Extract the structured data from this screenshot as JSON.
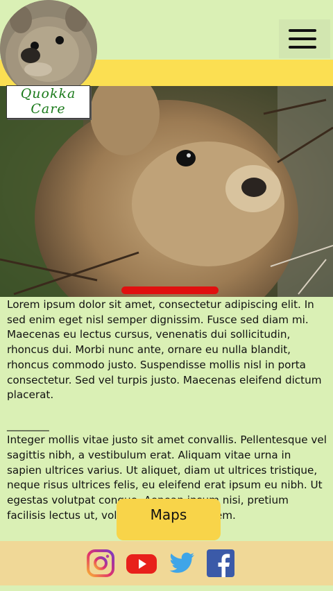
{
  "brand": {
    "logo_line1": "Quokka",
    "logo_line2": "Care"
  },
  "main": {
    "paragraph1": "Lorem ipsum dolor sit amet, consectetur adipiscing elit. In sed enim eget nisl semper dignissim. Fusce sed diam mi. Maecenas eu lectus cursus, venenatis dui sollicitudin, rhoncus dui. Morbi nunc ante, ornare eu nulla blandit, rhoncus commodo justo. Suspendisse mollis nisl in porta consectetur. Sed vel turpis justo. Maecenas eleifend dictum placerat.",
    "divider": "________",
    "paragraph2": "Integer mollis vitae justo sit amet convallis. Pellentesque vel sagittis nibh, a vestibulum erat. Aliquam vitae urna in sapien ultrices varius. Ut aliquet, diam ut ultrices tristique, neque risus ultrices felis, eu eleifend erat ipsum eu nibh. Ut egestas volutpat congue. Aenean ipsum nisi, pretium facilisis lectus ut, volutpat vestibulum sem.",
    "maps_button": "Maps"
  },
  "footer": {
    "icons": [
      "instagram-icon",
      "youtube-icon",
      "twitter-icon",
      "facebook-icon"
    ]
  },
  "colors": {
    "background": "#daf0b5",
    "header_band": "#fbdf52",
    "button": "#f8d449",
    "footer": "#f0d897",
    "slider_indicator": "#e0100f",
    "logo_text": "#1a7a1a"
  }
}
